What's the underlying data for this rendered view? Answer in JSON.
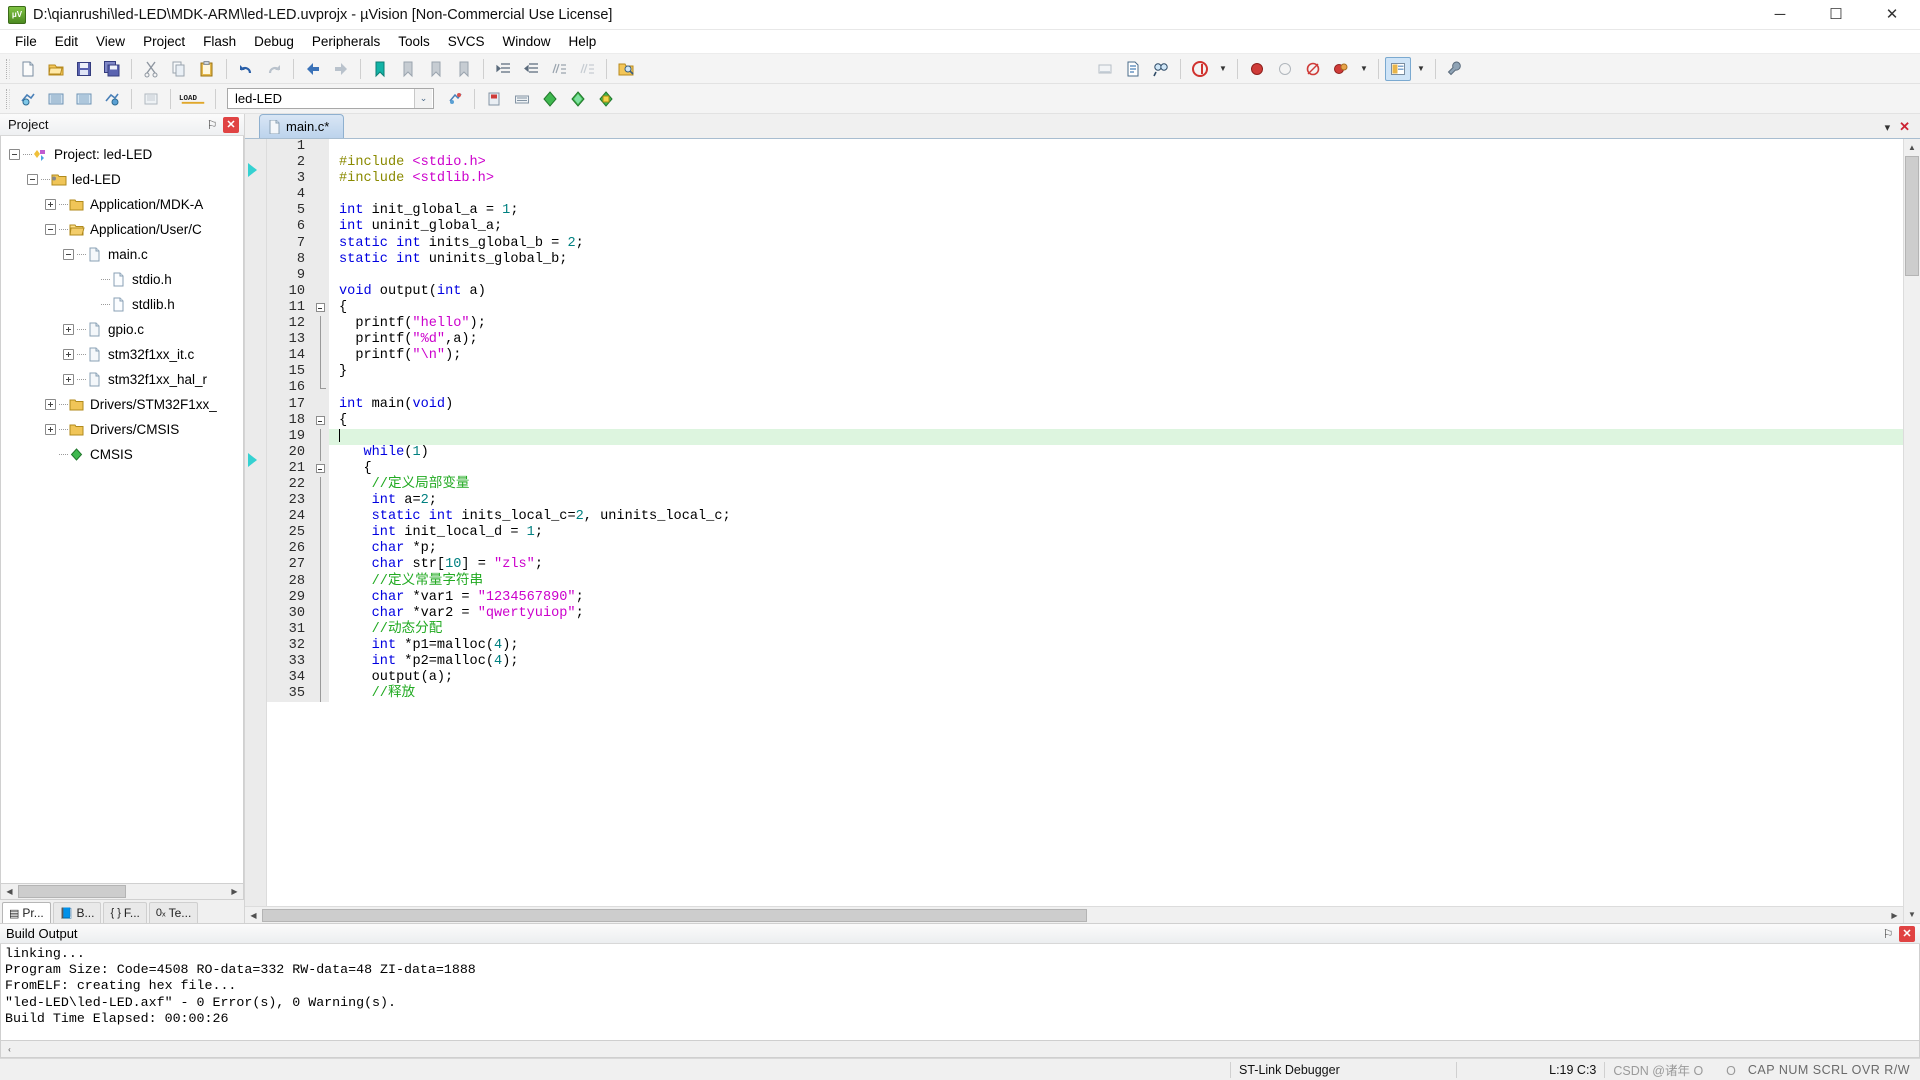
{
  "window": {
    "title": "D:\\qianrushi\\led-LED\\MDK-ARM\\led-LED.uvprojx - µVision  [Non-Commercial Use License]",
    "app_icon": "uvision-icon",
    "minimize": "─",
    "maximize": "☐",
    "close": "✕"
  },
  "menubar": {
    "items": [
      {
        "label": "File"
      },
      {
        "label": "Edit"
      },
      {
        "label": "View"
      },
      {
        "label": "Project"
      },
      {
        "label": "Flash"
      },
      {
        "label": "Debug"
      },
      {
        "label": "Peripherals"
      },
      {
        "label": "Tools"
      },
      {
        "label": "SVCS"
      },
      {
        "label": "Window"
      },
      {
        "label": "Help"
      }
    ]
  },
  "toolbar_main": {
    "buttons": [
      {
        "name": "new-file-icon",
        "glyph": "📄"
      },
      {
        "name": "open-file-icon",
        "glyph": "📂"
      },
      {
        "name": "save-icon",
        "glyph": "💾"
      },
      {
        "name": "save-all-icon",
        "glyph": "🗂"
      },
      {
        "name": "cut-icon",
        "glyph": "✂"
      },
      {
        "name": "copy-icon",
        "glyph": "❐"
      },
      {
        "name": "paste-icon",
        "glyph": "📋"
      },
      {
        "name": "undo-icon",
        "glyph": "↶"
      },
      {
        "name": "redo-icon",
        "glyph": "↷"
      },
      {
        "name": "navigate-backward-icon",
        "glyph": "←"
      },
      {
        "name": "navigate-forward-icon",
        "glyph": "→"
      },
      {
        "name": "bookmark-toggle-icon",
        "glyph": "🔖"
      },
      {
        "name": "bookmark-prev-icon",
        "glyph": "🔖"
      },
      {
        "name": "bookmark-next-icon",
        "glyph": "🔖"
      },
      {
        "name": "bookmark-clear-icon",
        "glyph": "🔖"
      },
      {
        "name": "indent-icon",
        "glyph": "≡"
      },
      {
        "name": "outdent-icon",
        "glyph": "≡"
      },
      {
        "name": "comment-icon",
        "glyph": "//≡"
      },
      {
        "name": "uncomment-icon",
        "glyph": "//≡"
      },
      {
        "name": "find-in-files-icon",
        "glyph": "🔍"
      }
    ],
    "right_buttons": [
      {
        "name": "insert-box-icon",
        "glyph": "▭"
      },
      {
        "name": "configure-icon",
        "glyph": "📝"
      },
      {
        "name": "find-icon",
        "glyph": "🔎"
      },
      {
        "name": "debug-session-icon",
        "glyph": "ⓓ"
      },
      {
        "name": "breakpoint-icon",
        "glyph": "●"
      },
      {
        "name": "breakpoint-disabled-icon",
        "glyph": "○"
      },
      {
        "name": "kill-breakpoints-icon",
        "glyph": "◌"
      },
      {
        "name": "disable-breakpoints-icon",
        "glyph": "●"
      },
      {
        "name": "manage-windows-icon",
        "glyph": "▤"
      },
      {
        "name": "configure-target-icon",
        "glyph": "🔧"
      }
    ]
  },
  "toolbar_build": {
    "buttons": [
      {
        "name": "translate-icon",
        "glyph": "⚙"
      },
      {
        "name": "build-icon",
        "glyph": "▦"
      },
      {
        "name": "rebuild-icon",
        "glyph": "▦"
      },
      {
        "name": "batch-build-icon",
        "glyph": "⚙"
      },
      {
        "name": "stop-build-icon",
        "glyph": "▣"
      },
      {
        "name": "download-icon",
        "glyph": "LOAD"
      }
    ],
    "target_selector": {
      "name": "target-combobox",
      "value": "led-LED",
      "dropdown_glyph": "⌄"
    },
    "right_buttons": [
      {
        "name": "target-options-icon",
        "glyph": "▭"
      },
      {
        "name": "target-options-2-icon",
        "glyph": "⚙"
      },
      {
        "name": "manage-project-items-icon",
        "glyph": "🗃"
      },
      {
        "name": "manage-run-time-icon",
        "glyph": "▤"
      },
      {
        "name": "components-green-icon",
        "glyph": "◆"
      },
      {
        "name": "components-cyan-icon",
        "glyph": "▽"
      },
      {
        "name": "pack-installer-icon",
        "glyph": "▣"
      }
    ]
  },
  "project_panel": {
    "caption": "Project",
    "pin_glyph": "⚐",
    "close_glyph": "✕",
    "tree": [
      {
        "label": "Project: led-LED",
        "depth": 0,
        "expander": "minus",
        "icon": "project-icon"
      },
      {
        "label": "led-LED",
        "depth": 1,
        "expander": "minus",
        "icon": "target-folder-icon"
      },
      {
        "label": "Application/MDK-A",
        "depth": 2,
        "expander": "plus",
        "icon": "group-folder-icon"
      },
      {
        "label": "Application/User/C",
        "depth": 2,
        "expander": "minus",
        "icon": "group-folder-open-icon"
      },
      {
        "label": "main.c",
        "depth": 3,
        "expander": "minus",
        "icon": "c-file-icon"
      },
      {
        "label": "stdio.h",
        "depth": 4,
        "expander": "none",
        "icon": "h-file-icon"
      },
      {
        "label": "stdlib.h",
        "depth": 4,
        "expander": "none",
        "icon": "h-file-icon"
      },
      {
        "label": "gpio.c",
        "depth": 3,
        "expander": "plus",
        "icon": "c-file-icon"
      },
      {
        "label": "stm32f1xx_it.c",
        "depth": 3,
        "expander": "plus",
        "icon": "c-file-icon"
      },
      {
        "label": "stm32f1xx_hal_r",
        "depth": 3,
        "expander": "plus",
        "icon": "c-file-icon"
      },
      {
        "label": "Drivers/STM32F1xx_",
        "depth": 2,
        "expander": "plus",
        "icon": "group-folder-icon"
      },
      {
        "label": "Drivers/CMSIS",
        "depth": 2,
        "expander": "plus",
        "icon": "group-folder-icon"
      },
      {
        "label": "CMSIS",
        "depth": 2,
        "expander": "none",
        "icon": "cmsis-icon"
      }
    ],
    "tabs": [
      {
        "label": "Pr...",
        "glyph": "▤",
        "selected": true
      },
      {
        "label": "B...",
        "glyph": "📘",
        "selected": false
      },
      {
        "label": "F...",
        "glyph": "{ }",
        "selected": false
      },
      {
        "label": "Te...",
        "glyph": "0ₓ",
        "selected": false
      }
    ],
    "hscroll": {
      "left_glyph": "◀",
      "right_glyph": "▶"
    }
  },
  "editor": {
    "tab": {
      "label": "main.c*",
      "icon": "c-file-icon"
    },
    "tabstrip_buttons": [
      {
        "name": "tab-list-icon",
        "glyph": "▾"
      },
      {
        "name": "close-document-icon",
        "glyph": "✕"
      }
    ],
    "lines": [
      {
        "n": 1,
        "fold": "none",
        "tokens": [],
        "current": false,
        "marker": "run-arrow"
      },
      {
        "n": 2,
        "fold": "none",
        "tokens": [
          {
            "t": "#include ",
            "c": "pre"
          },
          {
            "t": "<stdio.h>",
            "c": "inc"
          }
        ]
      },
      {
        "n": 3,
        "fold": "none",
        "tokens": [
          {
            "t": "#include ",
            "c": "pre"
          },
          {
            "t": "<stdlib.h>",
            "c": "inc"
          }
        ]
      },
      {
        "n": 4,
        "fold": "none",
        "tokens": []
      },
      {
        "n": 5,
        "fold": "none",
        "tokens": [
          {
            "t": "int",
            "c": "kw"
          },
          {
            "t": " init_global_a = ",
            "c": "plain"
          },
          {
            "t": "1",
            "c": "num"
          },
          {
            "t": ";",
            "c": "plain"
          }
        ]
      },
      {
        "n": 6,
        "fold": "none",
        "tokens": [
          {
            "t": "int",
            "c": "kw"
          },
          {
            "t": " uninit_global_a;",
            "c": "plain"
          }
        ]
      },
      {
        "n": 7,
        "fold": "none",
        "tokens": [
          {
            "t": "static",
            "c": "kw"
          },
          {
            "t": " ",
            "c": "plain"
          },
          {
            "t": "int",
            "c": "kw"
          },
          {
            "t": " inits_global_b = ",
            "c": "plain"
          },
          {
            "t": "2",
            "c": "num"
          },
          {
            "t": ";",
            "c": "plain"
          }
        ]
      },
      {
        "n": 8,
        "fold": "none",
        "tokens": [
          {
            "t": "static",
            "c": "kw"
          },
          {
            "t": " ",
            "c": "plain"
          },
          {
            "t": "int",
            "c": "kw"
          },
          {
            "t": " uninits_global_b;",
            "c": "plain"
          }
        ]
      },
      {
        "n": 9,
        "fold": "none",
        "tokens": []
      },
      {
        "n": 10,
        "fold": "none",
        "tokens": [
          {
            "t": "void",
            "c": "kw"
          },
          {
            "t": " output(",
            "c": "plain"
          },
          {
            "t": "int",
            "c": "kw"
          },
          {
            "t": " a)",
            "c": "plain"
          }
        ]
      },
      {
        "n": 11,
        "fold": "box",
        "tokens": [
          {
            "t": "{",
            "c": "plain"
          }
        ]
      },
      {
        "n": 12,
        "fold": "bar",
        "tokens": [
          {
            "t": "  printf(",
            "c": "plain"
          },
          {
            "t": "\"hello\"",
            "c": "str"
          },
          {
            "t": ");",
            "c": "plain"
          }
        ]
      },
      {
        "n": 13,
        "fold": "bar",
        "tokens": [
          {
            "t": "  printf(",
            "c": "plain"
          },
          {
            "t": "\"%d\"",
            "c": "str"
          },
          {
            "t": ",a);",
            "c": "plain"
          }
        ]
      },
      {
        "n": 14,
        "fold": "bar",
        "tokens": [
          {
            "t": "  printf(",
            "c": "plain"
          },
          {
            "t": "\"\\n\"",
            "c": "str"
          },
          {
            "t": ");",
            "c": "plain"
          }
        ]
      },
      {
        "n": 15,
        "fold": "bar",
        "tokens": [
          {
            "t": "}",
            "c": "plain"
          }
        ]
      },
      {
        "n": 16,
        "fold": "end",
        "tokens": []
      },
      {
        "n": 17,
        "fold": "none",
        "tokens": [
          {
            "t": "int",
            "c": "kw"
          },
          {
            "t": " main(",
            "c": "plain"
          },
          {
            "t": "void",
            "c": "kw"
          },
          {
            "t": ")",
            "c": "plain"
          }
        ]
      },
      {
        "n": 18,
        "fold": "box",
        "tokens": [
          {
            "t": "{",
            "c": "plain"
          }
        ]
      },
      {
        "n": 19,
        "fold": "bar",
        "tokens": [],
        "current": true,
        "marker": "run-arrow",
        "caret": true
      },
      {
        "n": 20,
        "fold": "bar",
        "tokens": [
          {
            "t": "   ",
            "c": "plain"
          },
          {
            "t": "while",
            "c": "kw"
          },
          {
            "t": "(",
            "c": "plain"
          },
          {
            "t": "1",
            "c": "num"
          },
          {
            "t": ")",
            "c": "plain"
          }
        ]
      },
      {
        "n": 21,
        "fold": "box",
        "tokens": [
          {
            "t": "   {",
            "c": "plain"
          }
        ]
      },
      {
        "n": 22,
        "fold": "bar",
        "tokens": [
          {
            "t": "    //定义局部变量",
            "c": "cmt"
          }
        ]
      },
      {
        "n": 23,
        "fold": "bar",
        "tokens": [
          {
            "t": "    ",
            "c": "plain"
          },
          {
            "t": "int",
            "c": "kw"
          },
          {
            "t": " a=",
            "c": "plain"
          },
          {
            "t": "2",
            "c": "num"
          },
          {
            "t": ";",
            "c": "plain"
          }
        ]
      },
      {
        "n": 24,
        "fold": "bar",
        "tokens": [
          {
            "t": "    ",
            "c": "plain"
          },
          {
            "t": "static",
            "c": "kw"
          },
          {
            "t": " ",
            "c": "plain"
          },
          {
            "t": "int",
            "c": "kw"
          },
          {
            "t": " inits_local_c=",
            "c": "plain"
          },
          {
            "t": "2",
            "c": "num"
          },
          {
            "t": ", uninits_local_c;",
            "c": "plain"
          }
        ]
      },
      {
        "n": 25,
        "fold": "bar",
        "tokens": [
          {
            "t": "    ",
            "c": "plain"
          },
          {
            "t": "int",
            "c": "kw"
          },
          {
            "t": " init_local_d = ",
            "c": "plain"
          },
          {
            "t": "1",
            "c": "num"
          },
          {
            "t": ";",
            "c": "plain"
          }
        ]
      },
      {
        "n": 26,
        "fold": "bar",
        "tokens": [
          {
            "t": "    ",
            "c": "plain"
          },
          {
            "t": "char",
            "c": "kw"
          },
          {
            "t": " *p;",
            "c": "plain"
          }
        ]
      },
      {
        "n": 27,
        "fold": "bar",
        "tokens": [
          {
            "t": "    ",
            "c": "plain"
          },
          {
            "t": "char",
            "c": "kw"
          },
          {
            "t": " str[",
            "c": "plain"
          },
          {
            "t": "10",
            "c": "num"
          },
          {
            "t": "] = ",
            "c": "plain"
          },
          {
            "t": "\"zls\"",
            "c": "str"
          },
          {
            "t": ";",
            "c": "plain"
          }
        ]
      },
      {
        "n": 28,
        "fold": "bar",
        "tokens": [
          {
            "t": "    //定义常量字符串",
            "c": "cmt"
          }
        ]
      },
      {
        "n": 29,
        "fold": "bar",
        "tokens": [
          {
            "t": "    ",
            "c": "plain"
          },
          {
            "t": "char",
            "c": "kw"
          },
          {
            "t": " *var1 = ",
            "c": "plain"
          },
          {
            "t": "\"1234567890\"",
            "c": "str"
          },
          {
            "t": ";",
            "c": "plain"
          }
        ]
      },
      {
        "n": 30,
        "fold": "bar",
        "tokens": [
          {
            "t": "    ",
            "c": "plain"
          },
          {
            "t": "char",
            "c": "kw"
          },
          {
            "t": " *var2 = ",
            "c": "plain"
          },
          {
            "t": "\"qwertyuiop\"",
            "c": "str"
          },
          {
            "t": ";",
            "c": "plain"
          }
        ]
      },
      {
        "n": 31,
        "fold": "bar",
        "tokens": [
          {
            "t": "    //动态分配",
            "c": "cmt"
          }
        ]
      },
      {
        "n": 32,
        "fold": "bar",
        "tokens": [
          {
            "t": "    ",
            "c": "plain"
          },
          {
            "t": "int",
            "c": "kw"
          },
          {
            "t": " *p1=malloc(",
            "c": "plain"
          },
          {
            "t": "4",
            "c": "num"
          },
          {
            "t": ");",
            "c": "plain"
          }
        ]
      },
      {
        "n": 33,
        "fold": "bar",
        "tokens": [
          {
            "t": "    ",
            "c": "plain"
          },
          {
            "t": "int",
            "c": "kw"
          },
          {
            "t": " *p2=malloc(",
            "c": "plain"
          },
          {
            "t": "4",
            "c": "num"
          },
          {
            "t": ");",
            "c": "plain"
          }
        ]
      },
      {
        "n": 34,
        "fold": "bar",
        "tokens": [
          {
            "t": "    output(a);",
            "c": "plain"
          }
        ]
      },
      {
        "n": 35,
        "fold": "bar",
        "tokens": [
          {
            "t": "    //释放",
            "c": "cmt"
          }
        ]
      }
    ]
  },
  "build_output": {
    "caption": "Build Output",
    "pin_glyph": "⚐",
    "close_glyph": "✕",
    "lines": [
      "linking...",
      "Program Size: Code=4508 RO-data=332 RW-data=48 ZI-data=1888",
      "FromELF: creating hex file...",
      "\"led-LED\\led-LED.axf\" - 0 Error(s), 0 Warning(s).",
      "Build Time Elapsed:  00:00:26"
    ],
    "scroll_left_glyph": "‹"
  },
  "statusbar": {
    "debugger": "ST-Link Debugger",
    "position": "L:19 C:3",
    "keys": "CAP NUM SCRL OVR R/W",
    "watermark": "CSDN @诸年 OㅤㅤO"
  }
}
